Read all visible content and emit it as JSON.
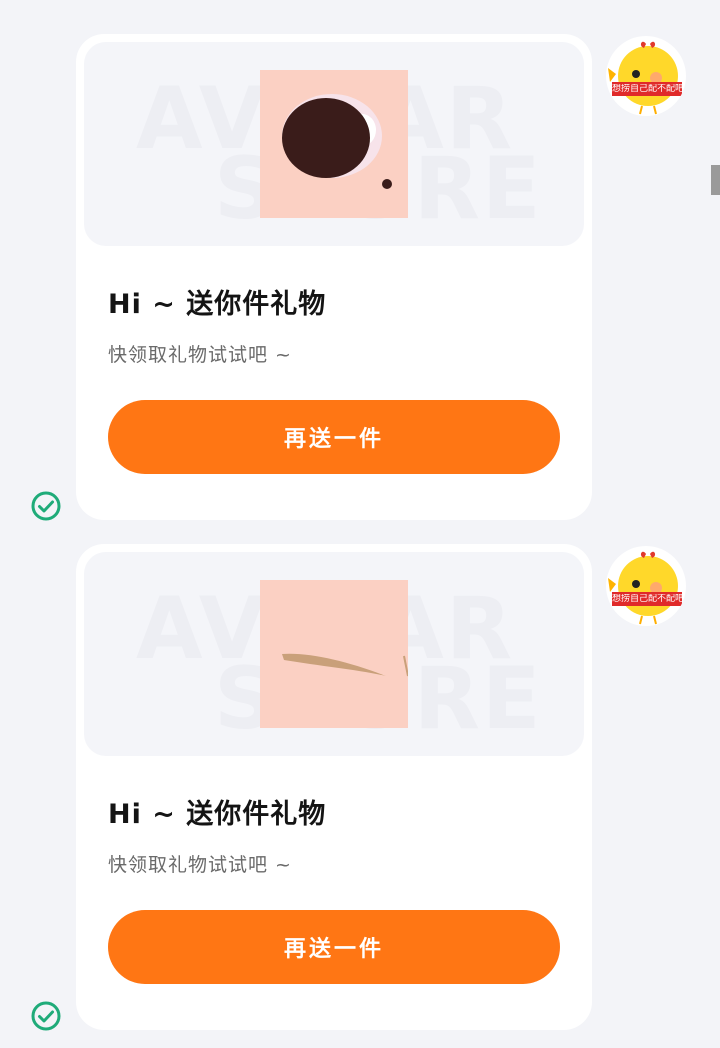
{
  "colors": {
    "accent": "#ff7614",
    "check": "#1fab79",
    "background": "#f3f4f8"
  },
  "messages": [
    {
      "watermark_line1": "AVATAR",
      "watermark_line2": "STORE",
      "preview_icon": "eye-part-thumbnail",
      "title": "Hi ~ 送你件礼物",
      "subtitle": "快领取礼物试试吧 ~",
      "button_label": "再送一件",
      "status_icon": "check-circle-icon",
      "avatar_caption": "想捞自己配不配吧"
    },
    {
      "watermark_line1": "AVATAR",
      "watermark_line2": "STORE",
      "preview_icon": "eyebrow-part-thumbnail",
      "title": "Hi ~ 送你件礼物",
      "subtitle": "快领取礼物试试吧 ~",
      "button_label": "再送一件",
      "status_icon": "check-circle-icon",
      "avatar_caption": "想捞自己配不配吧"
    }
  ]
}
